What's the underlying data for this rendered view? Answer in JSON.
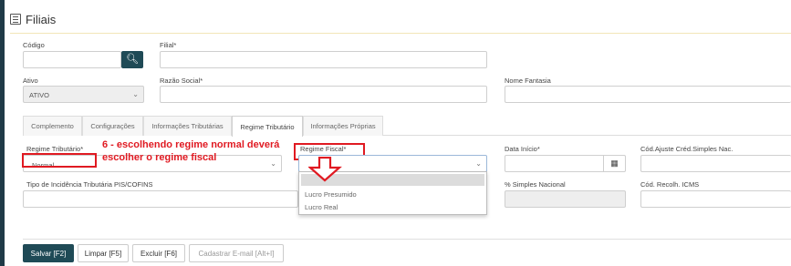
{
  "page": {
    "title": "Filiais"
  },
  "form": {
    "codigo_label": "Código",
    "filial_label": "Filial*",
    "ativo_label": "Ativo",
    "ativo_value": "ATIVO",
    "razao_label": "Razão Social*",
    "fantasia_label": "Nome Fantasia"
  },
  "tabs": [
    {
      "label": "Complemento"
    },
    {
      "label": "Configurações"
    },
    {
      "label": "Informações Tributárias"
    },
    {
      "label": "Regime Tributário"
    },
    {
      "label": "Informações Próprias"
    }
  ],
  "regime": {
    "regime_tributario_label": "Regime Tributário*",
    "regime_tributario_value": "Normal",
    "regime_fiscal_label": "Regime Fiscal*",
    "data_inicio_label": "Data Início*",
    "cod_ajuste_label": "Cód.Ajuste Créd.Simples Nac.",
    "tipo_incidencia_label": "Tipo de Incidência Tributária PIS/COFINS",
    "simples_label": "% Simples Nacional",
    "cod_recolh_label": "Cód. Recolh. ICMS",
    "dropdown_options": [
      "Lucro Presumido",
      "Lucro Real"
    ]
  },
  "annotation": "6 - escolhendo regime normal deverá escolher o regime fiscal",
  "buttons": {
    "salvar": "Salvar [F2]",
    "limpar": "Limpar [F5]",
    "excluir": "Excluir [F6]",
    "cadastrar": "Cadastrar E-mail [Alt+I]"
  },
  "colors": {
    "primary": "#1f4a56",
    "annotation_red": "#e01a22"
  }
}
